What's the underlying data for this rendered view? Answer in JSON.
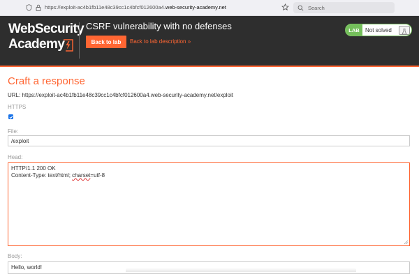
{
  "browser": {
    "url_prefix": "https://exploit-ac4b1fb11e48c39cc1c4bfcf012600a4.",
    "url_host": "web-security-academy.net",
    "search_placeholder": "Search"
  },
  "header": {
    "logo_line1": "WebSecurity",
    "logo_line2": "Academy",
    "lab_title": "CSRF vulnerability with no defenses",
    "back_to_lab": "Back to lab",
    "back_to_description": "Back to lab description »",
    "status_badge": "LAB",
    "status_text": "Not solved"
  },
  "main": {
    "heading": "Craft a response",
    "url_line": "URL: https://exploit-ac4b1fb11e48c39cc1c4bfcf012600a4.web-security-academy.net/exploit",
    "https_label": "HTTPS",
    "https_checked": true,
    "file_label": "File:",
    "file_value": "/exploit",
    "head_label": "Head:",
    "head_line1": "HTTP/1.1 200 OK",
    "head_line2_pre": "Content-Type: text/html; ",
    "head_line2_squiggly": "charset",
    "head_line2_post": "=utf-8",
    "body_label": "Body:",
    "body_value": "Hello, world!"
  },
  "colors": {
    "accent": "#ff6633",
    "header_bg": "#2e2e2e",
    "status_green": "#74bf5b",
    "checkbox_blue": "#1a73e8"
  }
}
